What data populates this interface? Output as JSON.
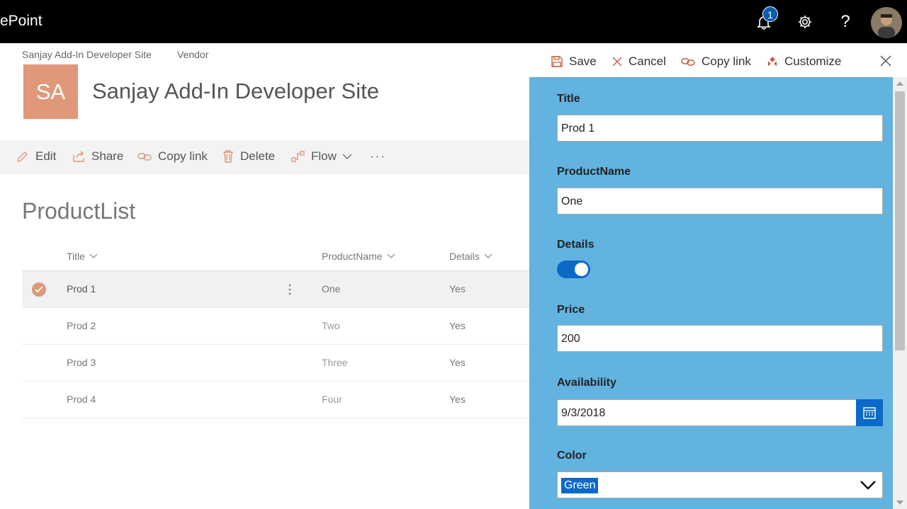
{
  "suite": {
    "brand": "ePoint",
    "notifications_count": "1",
    "settings_icon": "gear-icon",
    "help_label": "?"
  },
  "site": {
    "crumbs": [
      "Sanjay Add-In Developer Site",
      "Vendor"
    ],
    "logo_initials": "SA",
    "title": "Sanjay Add-In Developer Site"
  },
  "commandbar": {
    "edit": "Edit",
    "share": "Share",
    "copy_link": "Copy link",
    "delete": "Delete",
    "flow": "Flow",
    "more": "···"
  },
  "list": {
    "title": "ProductList",
    "columns": [
      "Title",
      "ProductName",
      "Details"
    ],
    "rows": [
      {
        "title": "Prod 1",
        "product": "One",
        "details": "Yes"
      },
      {
        "title": "Prod 2",
        "product": "Two",
        "details": "Yes"
      },
      {
        "title": "Prod 3",
        "product": "Three",
        "details": "Yes"
      },
      {
        "title": "Prod 4",
        "product": "Four",
        "details": "Yes"
      }
    ]
  },
  "panel": {
    "save": "Save",
    "cancel": "Cancel",
    "copy_link": "Copy link",
    "customize": "Customize",
    "fields": {
      "title_label": "Title",
      "title_value": "Prod 1",
      "productname_label": "ProductName",
      "productname_value": "One",
      "details_label": "Details",
      "details_on": true,
      "price_label": "Price",
      "price_value": "200",
      "availability_label": "Availability",
      "availability_value": "9/3/2018",
      "color_label": "Color",
      "color_value": "Green"
    }
  },
  "colors": {
    "accent": "#0b6ac7",
    "logo": "#e0987a",
    "form_bg": "#62b3e0",
    "suite_bar": "#000000"
  }
}
